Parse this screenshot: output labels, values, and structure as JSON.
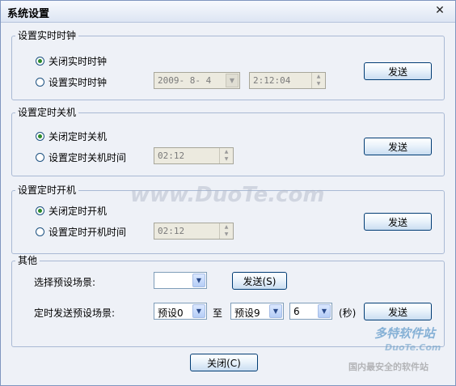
{
  "window": {
    "title": "系统设置",
    "close_icon": "close-icon"
  },
  "rtc": {
    "group_title": "设置实时时钟",
    "opt_off": "关闭实时时钟",
    "opt_set": "设置实时时钟",
    "date_value": "2009- 8- 4",
    "time_value": "2:12:04",
    "send_label": "发送"
  },
  "shutdown": {
    "group_title": "设置定时关机",
    "opt_off": "关闭定时关机",
    "opt_set": "设置定时关机时间",
    "time_value": "02:12",
    "send_label": "发送"
  },
  "poweron": {
    "group_title": "设置定时开机",
    "opt_off": "关闭定时开机",
    "opt_set": "设置定时开机时间",
    "time_value": "02:12",
    "send_label": "发送"
  },
  "other": {
    "group_title": "其他",
    "select_label": "选择预设场景:",
    "select_value": "",
    "send_s_label": "发送(S)",
    "timed_label": "定时发送预设场景:",
    "from_value": "预设0",
    "to_label": "至",
    "to_value": "预设9",
    "seconds_value": "6",
    "seconds_unit": "(秒)",
    "send_label": "发送"
  },
  "footer": {
    "close_label": "关闭(C)"
  },
  "watermark": {
    "center": "www.DuoTe.com",
    "logo": "多特软件站",
    "logo_url": "DuoTe.Com",
    "logo_tagline": "国内最安全的软件站"
  }
}
